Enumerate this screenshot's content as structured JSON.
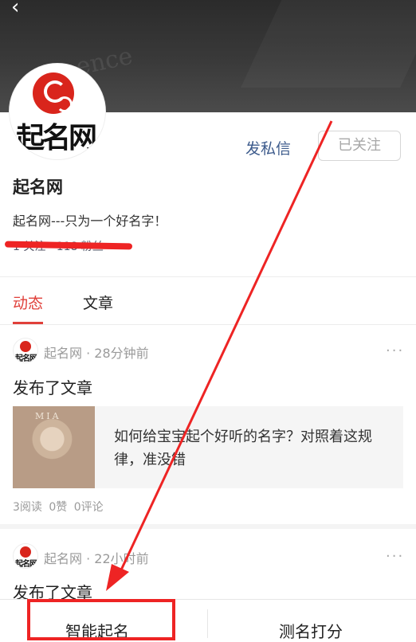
{
  "profile": {
    "logo_text": "起名网",
    "name": "起名网",
    "bio": "起名网---只为一个好名字！",
    "message_label": "发私信",
    "follow_label": "已关注",
    "stats_text": "1 关注 · 118 粉丝"
  },
  "tabs": [
    {
      "label": "动态",
      "active": true
    },
    {
      "label": "文章",
      "active": false
    }
  ],
  "feed": [
    {
      "author": "起名网",
      "time": "· 28分钟前",
      "action": "发布了文章",
      "article": {
        "thumb_text": "MIA",
        "title": "如何给宝宝起个好听的名字？对照着这规律，准没错"
      },
      "counts": "3阅读 0赞 0评论"
    },
    {
      "author": "起名网",
      "time": "· 22小时前",
      "action": "发布了文章"
    }
  ],
  "more_icon": "···",
  "bottom_bar": {
    "left_label": "智能起名",
    "right_label": "测名打分"
  },
  "annotation_color": "#ee2424",
  "accent_color": "#e0403a"
}
